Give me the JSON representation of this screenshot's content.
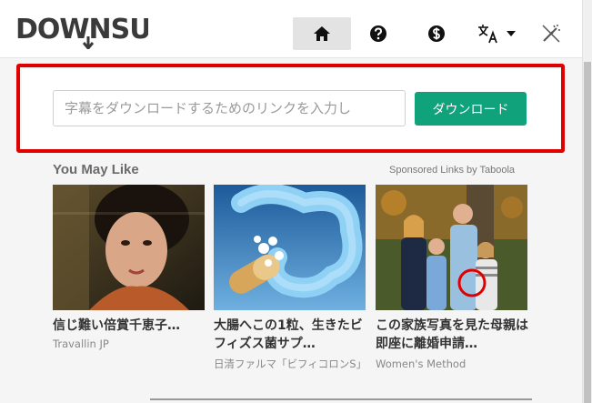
{
  "header": {
    "logo_text": "DOWNSUB",
    "nav": [
      {
        "name": "home",
        "icon": "home-icon"
      },
      {
        "name": "help",
        "icon": "question-icon"
      },
      {
        "name": "donate",
        "icon": "dollar-icon"
      },
      {
        "name": "language",
        "icon": "translate-icon"
      },
      {
        "name": "theme",
        "icon": "magic-wand-icon"
      }
    ]
  },
  "search": {
    "placeholder": "字幕をダウンロードするためのリンクを入力し",
    "value": "",
    "button_label": "ダウンロード"
  },
  "sponsored": {
    "heading": "You May Like",
    "by_label": "Sponsored Links by Taboola",
    "cards": [
      {
        "title": "信じ難い倍賞千恵子…",
        "source": "Travallin JP"
      },
      {
        "title": "大腸へこの1粒、生きたビフィズス菌サプ…",
        "source": "日清ファルマ「ビフィコロンS」"
      },
      {
        "title": "この家族写真を見た母親は即座に離婚申請…",
        "source": "Women's Method"
      }
    ]
  },
  "colors": {
    "accent": "#10a27a",
    "highlight_frame": "#e00000"
  }
}
